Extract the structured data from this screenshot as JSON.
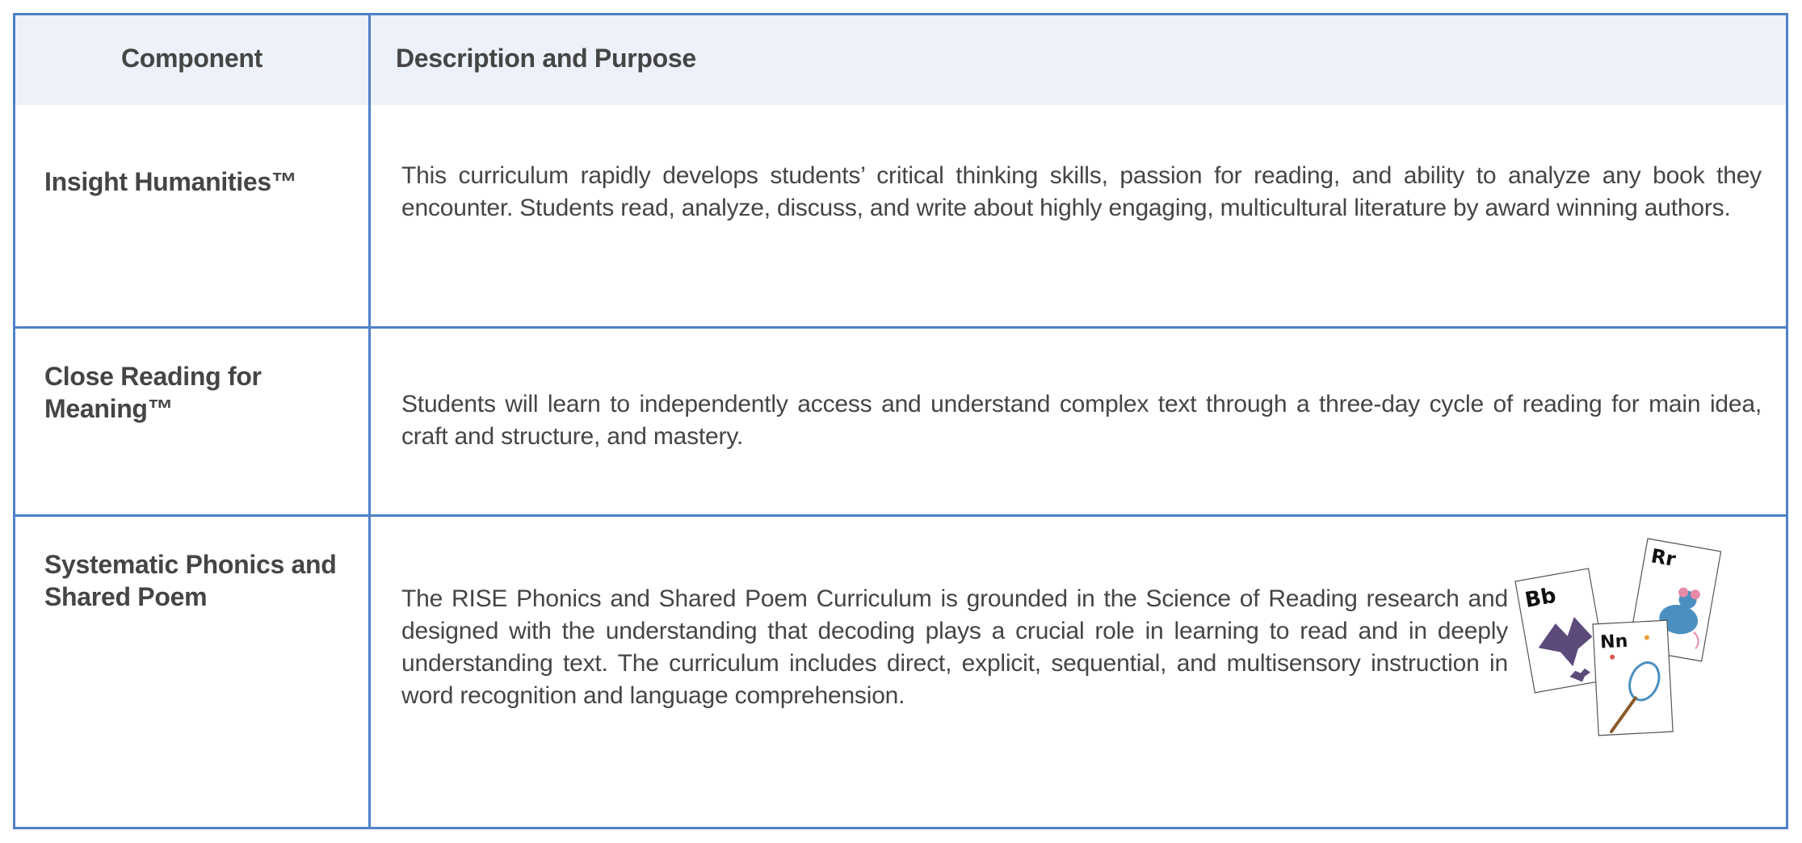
{
  "table": {
    "headers": {
      "component": "Component",
      "description": "Description and Purpose"
    },
    "rows": [
      {
        "component": "Insight Humanities™",
        "description": "This curriculum rapidly develops students’ critical thinking skills, passion for reading, and ability to analyze any book they encounter. Students read, analyze, discuss, and write about highly engaging, multicultural literature by award winning authors."
      },
      {
        "component": "Close Reading for Meaning™",
        "description": "Students will learn to independently access and understand complex text through a three-day cycle of reading for main idea, craft and structure, and mastery."
      },
      {
        "component": "Systematic Phonics and Shared Poem",
        "description": "The RISE Phonics and Shared Poem Curriculum is grounded in the Science of Reading research and designed with the understanding that decoding plays a crucial role in learning to read and in deeply understanding text. The curriculum includes direct, explicit, sequential, and multisensory instruction in word recognition and language comprehension."
      }
    ],
    "letter_cards": [
      "Bb",
      "Rr",
      "Nn"
    ]
  },
  "colors": {
    "border": "#4f81c7",
    "header_bg": "#ecf1fa",
    "text": "#454545"
  }
}
